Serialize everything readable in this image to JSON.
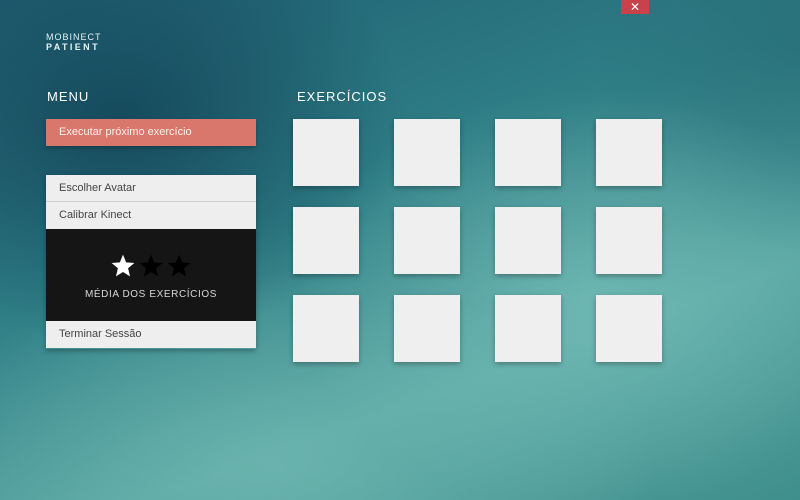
{
  "window": {
    "close_label": "✕"
  },
  "logo": {
    "line1": "MOBINECT",
    "line2": "PATIENT"
  },
  "menu": {
    "title": "MENU",
    "primary_action": "Executar próximo exercício",
    "items": [
      {
        "label": "Escolher Avatar"
      },
      {
        "label": "Calibrar Kinect"
      }
    ],
    "rating": {
      "label": "MÉDIA DOS EXERCÍCIOS",
      "stars_filled": 1,
      "stars_total": 3,
      "filled_color": "#ffffff",
      "empty_color": "#000000"
    },
    "end_session": "Terminar Sessão"
  },
  "exercises": {
    "title": "EXERCÍCIOS",
    "tile_count": 12
  },
  "colors": {
    "accent": "#d9776c",
    "close": "#c9414a",
    "tile": "#efefef"
  }
}
